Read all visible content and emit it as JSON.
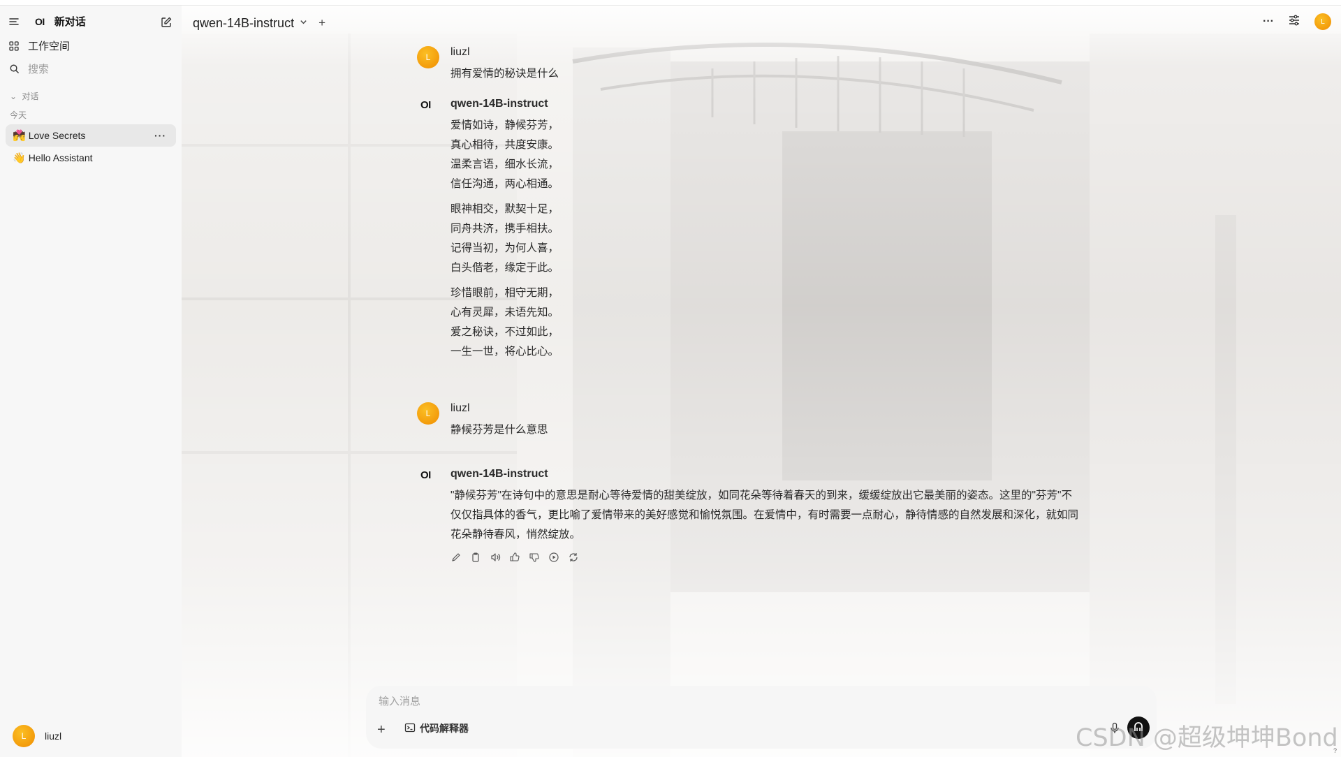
{
  "sidebar": {
    "logo": "OI",
    "new_chat": "新对话",
    "workspace": "工作空间",
    "search_placeholder": "搜索",
    "section": "对话",
    "group": "今天",
    "chats": [
      {
        "emoji": "💏",
        "title": "Love Secrets",
        "active": true
      },
      {
        "emoji": "👋",
        "title": "Hello Assistant",
        "active": false
      }
    ],
    "user": {
      "initial": "L",
      "name": "liuzl"
    }
  },
  "header": {
    "model": "qwen-14B-instruct",
    "avatar_initial": "L"
  },
  "messages": [
    {
      "role": "user",
      "name": "liuzl",
      "avatar": "L",
      "text": "拥有爱情的秘诀是什么"
    },
    {
      "role": "assistant",
      "name": "qwen-14B-instruct",
      "avatar": "OI",
      "stanzas": [
        [
          "爱情如诗，静候芬芳，",
          "真心相待，共度安康。",
          "温柔言语，细水长流，",
          "信任沟通，两心相通。"
        ],
        [
          "眼神相交，默契十足，",
          "同舟共济，携手相扶。",
          "记得当初，为何人喜，",
          "白头偕老，缘定于此。"
        ],
        [
          "珍惜眼前，相守无期，",
          "心有灵犀，未语先知。",
          "爱之秘诀，不过如此，",
          "一生一世，将心比心。"
        ]
      ]
    },
    {
      "role": "user",
      "name": "liuzl",
      "avatar": "L",
      "text": "静候芬芳是什么意思"
    },
    {
      "role": "assistant",
      "name": "qwen-14B-instruct",
      "avatar": "OI",
      "lines": [
        "\"静候芬芳\"在诗句中的意思是耐心等待爱情的甜美绽放，如同花朵等待着春天的到来，缓缓绽放出它最美丽的姿态。这里的\"芬芳\"不",
        "仅仅指具体的香气，更比喻了爱情带来的美好感觉和愉悦氛围。在爱情中，有时需要一点耐心，静待情感的自然发展和深化，就如同",
        "花朵静待春风，悄然绽放。"
      ]
    }
  ],
  "composer": {
    "placeholder": "输入消息",
    "value": "",
    "tool_label": "代码解释器"
  },
  "watermark": "CSDN @超级坤坤Bond",
  "help": "?"
}
